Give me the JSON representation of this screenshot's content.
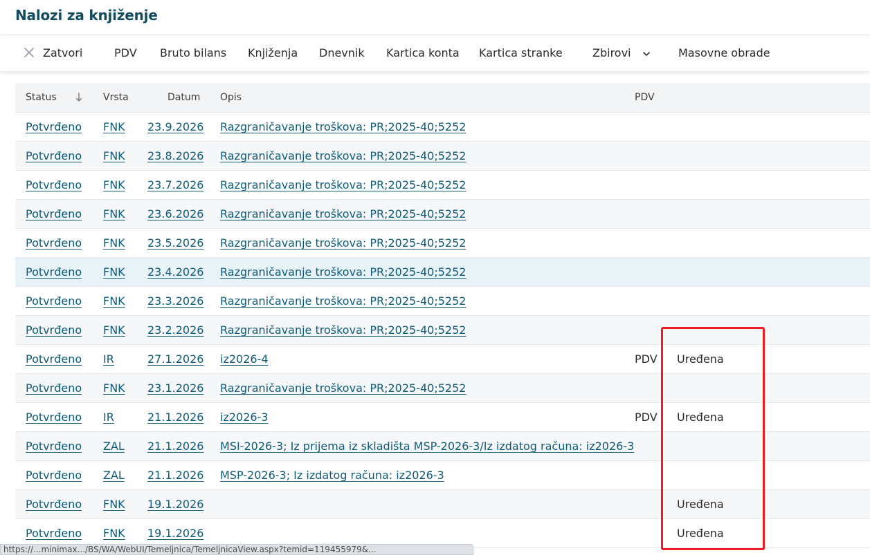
{
  "page": {
    "title": "Nalozi za knjiženje"
  },
  "toolbar": {
    "close_label": "Zatvori",
    "items": [
      "PDV",
      "Bruto bilans",
      "Knjiženja",
      "Dnevnik",
      "Kartica konta",
      "Kartica stranke"
    ],
    "zbirovi_label": "Zbirovi",
    "masovne_label": "Masovne obrade"
  },
  "table": {
    "columns": {
      "status": "Status",
      "vrsta": "Vrsta",
      "datum": "Datum",
      "opis": "Opis",
      "pdv": "PDV"
    },
    "rows": [
      {
        "status": "Potvrđeno",
        "vrsta": "FNK",
        "datum": "23.9.2026",
        "opis": "Razgraničavanje troškova: PR;2025-40;5252",
        "pdv": "",
        "ured": ""
      },
      {
        "status": "Potvrđeno",
        "vrsta": "FNK",
        "datum": "23.8.2026",
        "opis": "Razgraničavanje troškova: PR;2025-40;5252",
        "pdv": "",
        "ured": ""
      },
      {
        "status": "Potvrđeno",
        "vrsta": "FNK",
        "datum": "23.7.2026",
        "opis": "Razgraničavanje troškova: PR;2025-40;5252",
        "pdv": "",
        "ured": ""
      },
      {
        "status": "Potvrđeno",
        "vrsta": "FNK",
        "datum": "23.6.2026",
        "opis": "Razgraničavanje troškova: PR;2025-40;5252",
        "pdv": "",
        "ured": ""
      },
      {
        "status": "Potvrđeno",
        "vrsta": "FNK",
        "datum": "23.5.2026",
        "opis": "Razgraničavanje troškova: PR;2025-40;5252",
        "pdv": "",
        "ured": ""
      },
      {
        "status": "Potvrđeno",
        "vrsta": "FNK",
        "datum": "23.4.2026",
        "opis": "Razgraničavanje troškova: PR;2025-40;5252",
        "pdv": "",
        "ured": ""
      },
      {
        "status": "Potvrđeno",
        "vrsta": "FNK",
        "datum": "23.3.2026",
        "opis": "Razgraničavanje troškova: PR;2025-40;5252",
        "pdv": "",
        "ured": ""
      },
      {
        "status": "Potvrđeno",
        "vrsta": "FNK",
        "datum": "23.2.2026",
        "opis": "Razgraničavanje troškova: PR;2025-40;5252",
        "pdv": "",
        "ured": ""
      },
      {
        "status": "Potvrđeno",
        "vrsta": "IR",
        "datum": "27.1.2026",
        "opis": "iz2026-4",
        "pdv": "PDV",
        "ured": "Uređena"
      },
      {
        "status": "Potvrđeno",
        "vrsta": "FNK",
        "datum": "23.1.2026",
        "opis": "Razgraničavanje troškova: PR;2025-40;5252",
        "pdv": "",
        "ured": ""
      },
      {
        "status": "Potvrđeno",
        "vrsta": "IR",
        "datum": "21.1.2026",
        "opis": "iz2026-3",
        "pdv": "PDV",
        "ured": "Uređena"
      },
      {
        "status": "Potvrđeno",
        "vrsta": "ZAL",
        "datum": "21.1.2026",
        "opis": "MSI-2026-3; Iz prijema iz skladišta MSP-2026-3/Iz izdatog računa: iz2026-3",
        "pdv": "",
        "ured": ""
      },
      {
        "status": "Potvrđeno",
        "vrsta": "ZAL",
        "datum": "21.1.2026",
        "opis": "MSP-2026-3; Iz izdatog računa: iz2026-3",
        "pdv": "",
        "ured": ""
      },
      {
        "status": "Potvrđeno",
        "vrsta": "FNK",
        "datum": "19.1.2026",
        "opis": "",
        "pdv": "",
        "ured": "Uređena"
      },
      {
        "status": "Potvrđeno",
        "vrsta": "FNK",
        "datum": "19.1.2026",
        "opis": "",
        "pdv": "",
        "ured": "Uređena"
      }
    ],
    "highlighted_row_index": 5
  },
  "statusbar": {
    "url": "https://...minimax.../BS/WA/WebUI/Temeljnica/TemeljnicaView.aspx?temid=119455979&..."
  },
  "colors": {
    "title": "#124a60",
    "link": "#0e5a78",
    "highlight_row": "#e8f3f8",
    "annotation": "#ee1c24"
  }
}
